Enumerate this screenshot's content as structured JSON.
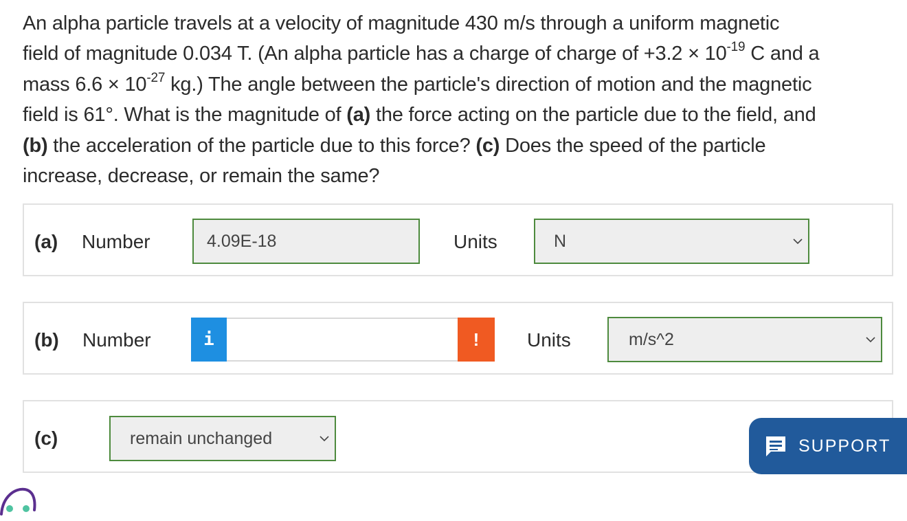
{
  "question": {
    "line1": "An alpha particle travels at a velocity of magnitude 430 m/s through a uniform magnetic",
    "line2_pre": "field of magnitude 0.034 T. (An alpha particle has a charge of charge of +3.2 × 10",
    "line2_exp": "-19",
    "line2_post": " C and a",
    "line3_pre": "mass 6.6 × 10",
    "line3_exp": "-27",
    "line3_post": " kg.) The angle between the particle's direction of motion and the magnetic",
    "line4_pre": "field is 61°. What is the magnitude of ",
    "line4_a": "(a)",
    "line4_post": " the force acting on the particle due to the field, and",
    "line5_b": "(b)",
    "line5_mid": " the acceleration of the particle due to this force? ",
    "line5_c": "(c)",
    "line5_post": " Does the speed of the particle",
    "line6": "increase, decrease, or remain the same?"
  },
  "part_a": {
    "label": "(a)",
    "number_label": "Number",
    "answer_value": "4.09E-18",
    "units_label": "Units",
    "units_value": "N"
  },
  "part_b": {
    "label": "(b)",
    "number_label": "Number",
    "info_icon_text": "i",
    "answer_value": "",
    "warning_icon_text": "!",
    "units_label": "Units",
    "units_value": "m/s^2"
  },
  "part_c": {
    "label": "(c)",
    "select_value": "remain unchanged"
  },
  "support": {
    "label": "SUPPORT"
  },
  "colors": {
    "field_border": "#4d8a3d",
    "info_blue": "#1e8fe1",
    "warning_orange": "#f05a22",
    "support_blue": "#215a9b"
  }
}
